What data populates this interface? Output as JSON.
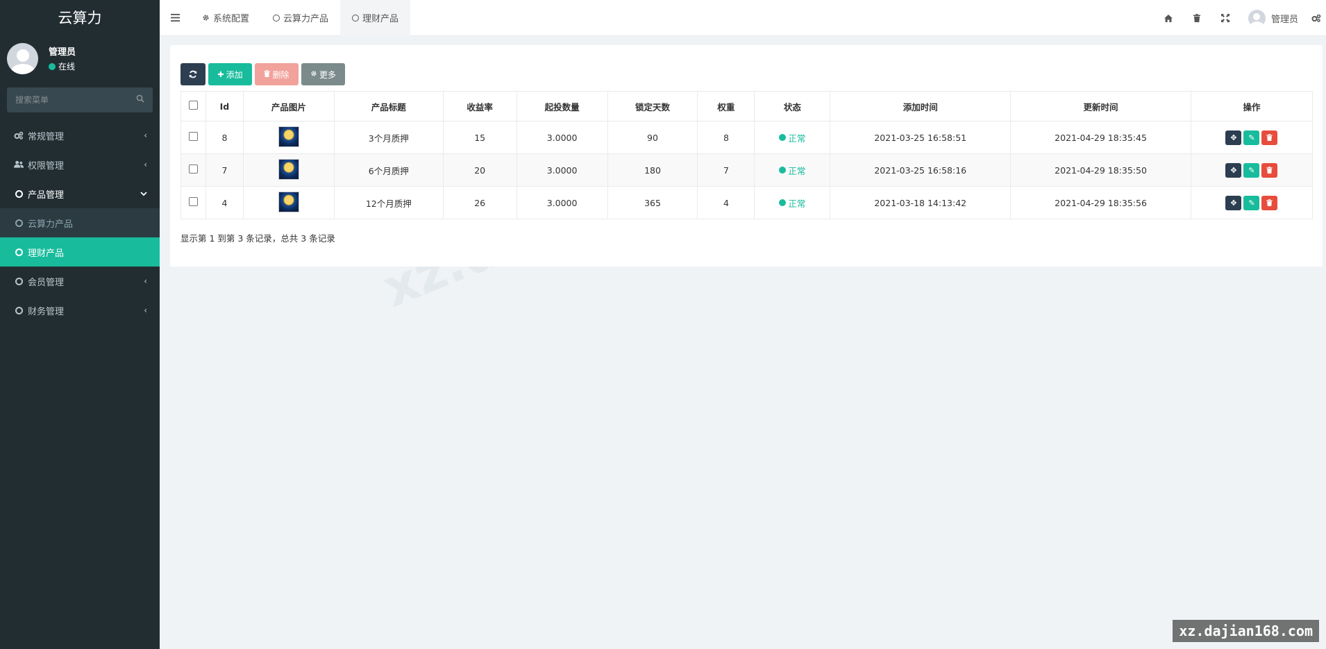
{
  "app": {
    "logo": "云算力"
  },
  "user": {
    "name": "管理员",
    "status": "在线"
  },
  "search": {
    "placeholder": "搜索菜单"
  },
  "sidebar": {
    "items": [
      {
        "label": "常规管理",
        "icon": "cogs-icon"
      },
      {
        "label": "权限管理",
        "icon": "users-icon"
      },
      {
        "label": "产品管理",
        "icon": "circle-icon"
      },
      {
        "label": "会员管理",
        "icon": "circle-icon"
      },
      {
        "label": "财务管理",
        "icon": "circle-icon"
      }
    ],
    "subitems": [
      {
        "label": "云算力产品"
      },
      {
        "label": "理财产品"
      }
    ]
  },
  "tabs": [
    {
      "label": "系统配置"
    },
    {
      "label": "云算力产品"
    },
    {
      "label": "理财产品"
    }
  ],
  "topbar": {
    "user_name": "管理员"
  },
  "toolbar": {
    "add_label": "添加",
    "delete_label": "删除",
    "more_label": "更多"
  },
  "table": {
    "headers": [
      "Id",
      "产品图片",
      "产品标题",
      "收益率",
      "起投数量",
      "锁定天数",
      "权重",
      "状态",
      "添加时间",
      "更新时间",
      "操作"
    ],
    "rows": [
      {
        "id": "8",
        "title": "3个月质押",
        "rate": "15",
        "min": "3.0000",
        "days": "90",
        "weight": "8",
        "status": "正常",
        "created": "2021-03-25 16:58:51",
        "updated": "2021-04-29 18:35:45"
      },
      {
        "id": "7",
        "title": "6个月质押",
        "rate": "20",
        "min": "3.0000",
        "days": "180",
        "weight": "7",
        "status": "正常",
        "created": "2021-03-25 16:58:16",
        "updated": "2021-04-29 18:35:50"
      },
      {
        "id": "4",
        "title": "12个月质押",
        "rate": "26",
        "min": "3.0000",
        "days": "365",
        "weight": "4",
        "status": "正常",
        "created": "2021-03-18 14:13:42",
        "updated": "2021-04-29 18:35:56"
      }
    ]
  },
  "pager": {
    "info": "显示第 1 到第 3 条记录，总共 3 条记录"
  },
  "watermark": {
    "text": "xz.dajian168.com",
    "corner": "xz.dajian168.com"
  },
  "colors": {
    "accent": "#18bc9c",
    "sidebar": "#222d32",
    "danger": "#e74c3c",
    "dark": "#2c3e50"
  }
}
